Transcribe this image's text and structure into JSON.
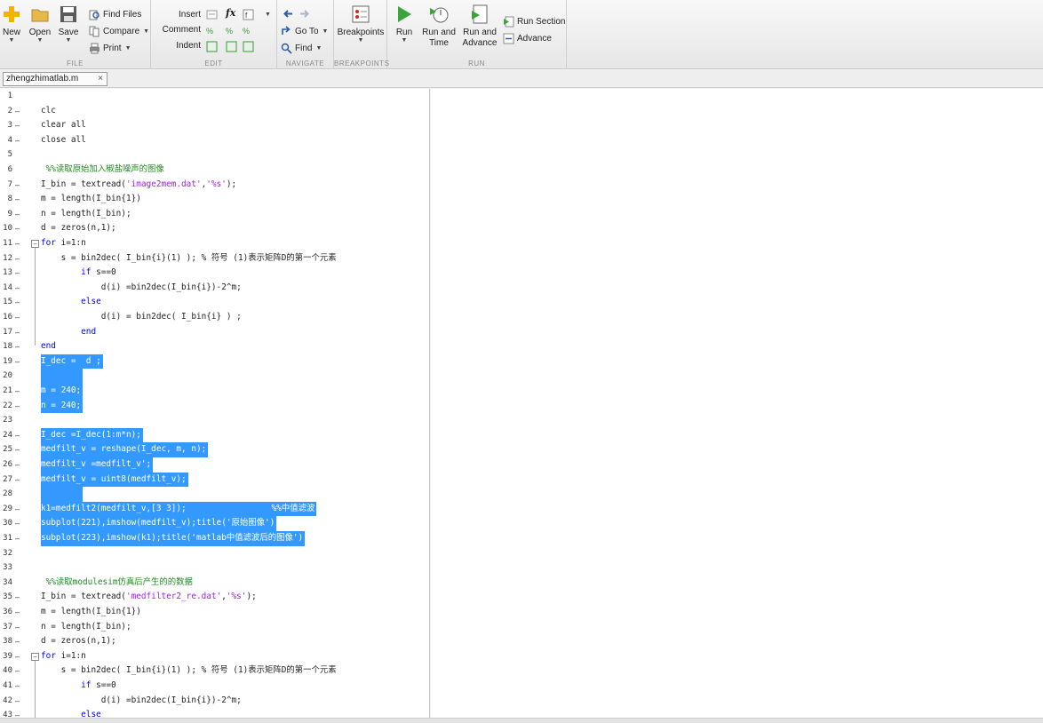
{
  "ribbon": {
    "file": {
      "title": "FILE",
      "new_label": "New",
      "open_label": "Open",
      "save_label": "Save",
      "find_files_label": "Find Files",
      "compare_label": "Compare",
      "print_label": "Print"
    },
    "edit": {
      "title": "EDIT",
      "insert_label": "Insert",
      "comment_label": "Comment",
      "indent_label": "Indent",
      "fx_label": "fx"
    },
    "navigate": {
      "title": "NAVIGATE",
      "goto_label": "Go To",
      "find_label": "Find"
    },
    "breakpoints": {
      "title": "BREAKPOINTS",
      "breakpoints_label": "Breakpoints"
    },
    "run": {
      "title": "RUN",
      "run_label": "Run",
      "run_and_time_label1": "Run and",
      "run_and_time_label2": "Time",
      "run_and_advance_label1": "Run and",
      "run_and_advance_label2": "Advance",
      "run_section_label": "Run Section",
      "advance_label": "Advance"
    }
  },
  "tab": {
    "filename": "zhengzhimatlab.m",
    "close": "×"
  },
  "code_lines": [
    {
      "n": "1",
      "dash": false,
      "text": "",
      "sel": false
    },
    {
      "n": "2",
      "dash": true,
      "text": "clc",
      "sel": false
    },
    {
      "n": "3",
      "dash": true,
      "text": "clear all",
      "sel": false
    },
    {
      "n": "4",
      "dash": true,
      "text": "close all",
      "sel": false
    },
    {
      "n": "5",
      "dash": false,
      "text": "",
      "sel": false
    },
    {
      "n": "6",
      "dash": false,
      "text": " %%读取原始加入椒盐噪声的图像",
      "sel": false
    },
    {
      "n": "7",
      "dash": true,
      "text": "I_bin = textread('image2mem.dat','%s');",
      "sel": false
    },
    {
      "n": "8",
      "dash": true,
      "text": "m = length(I_bin{1})",
      "sel": false
    },
    {
      "n": "9",
      "dash": true,
      "text": "n = length(I_bin);",
      "sel": false
    },
    {
      "n": "10",
      "dash": true,
      "text": "d = zeros(n,1);",
      "sel": false
    },
    {
      "n": "11",
      "dash": true,
      "text": "for i=1:n",
      "sel": false
    },
    {
      "n": "12",
      "dash": true,
      "text": "    s = bin2dec( I_bin{i}(1) ); % 符号 (1)表示矩阵D的第一个元素",
      "sel": false
    },
    {
      "n": "13",
      "dash": true,
      "text": "        if s==0",
      "sel": false
    },
    {
      "n": "14",
      "dash": true,
      "text": "            d(i) =bin2dec(I_bin{i})-2^m;",
      "sel": false
    },
    {
      "n": "15",
      "dash": true,
      "text": "        else",
      "sel": false
    },
    {
      "n": "16",
      "dash": true,
      "text": "            d(i) = bin2dec( I_bin{i} ) ;",
      "sel": false
    },
    {
      "n": "17",
      "dash": true,
      "text": "        end",
      "sel": false
    },
    {
      "n": "18",
      "dash": true,
      "text": "end",
      "sel": false
    },
    {
      "n": "19",
      "dash": true,
      "text": "I_dec =  d ;",
      "sel": true
    },
    {
      "n": "20",
      "dash": false,
      "text": "        ",
      "sel": true
    },
    {
      "n": "21",
      "dash": true,
      "text": "m = 240;",
      "sel": true
    },
    {
      "n": "22",
      "dash": true,
      "text": "n = 240;",
      "sel": true
    },
    {
      "n": "23",
      "dash": false,
      "text": "",
      "sel": false
    },
    {
      "n": "24",
      "dash": true,
      "text": "I_dec =I_dec(1:m*n);",
      "sel": true
    },
    {
      "n": "25",
      "dash": true,
      "text": "medfilt_v = reshape(I_dec, m, n);",
      "sel": true
    },
    {
      "n": "26",
      "dash": true,
      "text": "medfilt_v =medfilt_v';",
      "sel": true
    },
    {
      "n": "27",
      "dash": true,
      "text": "medfilt_v = uint8(medfilt_v);",
      "sel": true
    },
    {
      "n": "28",
      "dash": false,
      "text": "        ",
      "sel": true
    },
    {
      "n": "29",
      "dash": true,
      "text": "k1=medfilt2(medfilt_v,[3 3]);                 %%中值滤波",
      "sel": true
    },
    {
      "n": "30",
      "dash": true,
      "text": "subplot(221),imshow(medfilt_v);title('原始图像')",
      "sel": true
    },
    {
      "n": "31",
      "dash": true,
      "text": "subplot(223),imshow(k1);title('matlab中值滤波后的图像')",
      "sel": true
    },
    {
      "n": "32",
      "dash": false,
      "text": "",
      "sel": false
    },
    {
      "n": "33",
      "dash": false,
      "text": "",
      "sel": false
    },
    {
      "n": "34",
      "dash": false,
      "text": " %%读取modulesim仿真后产生的的数据",
      "sel": false
    },
    {
      "n": "35",
      "dash": true,
      "text": "I_bin = textread('medfilter2_re.dat','%s');",
      "sel": false
    },
    {
      "n": "36",
      "dash": true,
      "text": "m = length(I_bin{1})",
      "sel": false
    },
    {
      "n": "37",
      "dash": true,
      "text": "n = length(I_bin);",
      "sel": false
    },
    {
      "n": "38",
      "dash": true,
      "text": "d = zeros(n,1);",
      "sel": false
    },
    {
      "n": "39",
      "dash": true,
      "text": "for i=1:n",
      "sel": false
    },
    {
      "n": "40",
      "dash": true,
      "text": "    s = bin2dec( I_bin{i}(1) ); % 符号 (1)表示矩阵D的第一个元素",
      "sel": false
    },
    {
      "n": "41",
      "dash": true,
      "text": "        if s==0",
      "sel": false
    },
    {
      "n": "42",
      "dash": true,
      "text": "            d(i) =bin2dec(I_bin{i})-2^m;",
      "sel": false
    },
    {
      "n": "43",
      "dash": true,
      "text": "        else",
      "sel": false
    }
  ]
}
